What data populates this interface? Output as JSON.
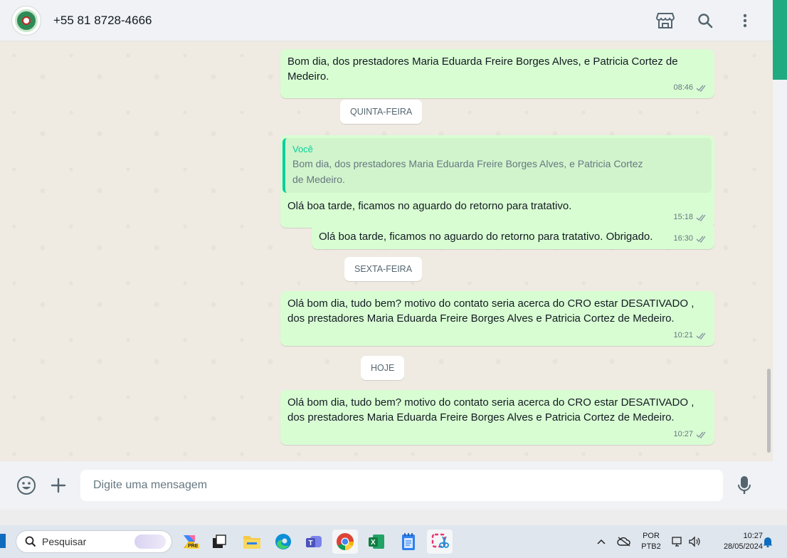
{
  "header": {
    "contact_name": "+55 81 8728-4666",
    "icons": [
      "store-icon",
      "search-icon",
      "more-vertical-icon"
    ],
    "accent": "#1faa80"
  },
  "messages": [
    {
      "text": "Bom dia, dos prestadores Maria Eduarda Freire Borges Alves, e Patricia Cortez de Medeiro.",
      "time": "08:46"
    },
    {
      "date": "QUINTA-FEIRA"
    },
    {
      "quote_author": "Você",
      "quote_text": "Bom dia, dos prestadores Maria Eduarda Freire Borges Alves, e Patricia Cortez de Medeiro.",
      "text": "Olá boa tarde, ficamos no aguardo do retorno para tratativo.",
      "time": "15:18"
    },
    {
      "text": "Olá boa tarde, ficamos no aguardo do retorno para tratativo. Obrigado.",
      "time": "16:30"
    },
    {
      "date": "SEXTA-FEIRA"
    },
    {
      "text": "Olá bom dia, tudo bem? motivo do contato seria acerca do CRO estar DESATIVADO , dos prestadores Maria Eduarda Freire Borges Alves e Patricia Cortez de Medeiro.",
      "time": "10:21"
    },
    {
      "date": "HOJE"
    },
    {
      "text": "Olá bom dia, tudo bem? motivo do contato seria acerca do CRO estar DESATIVADO , dos prestadores Maria Eduarda Freire Borges Alves e Patricia Cortez de Medeiro.",
      "time": "10:27"
    }
  ],
  "composer": {
    "placeholder": "Digite uma mensagem",
    "icons": [
      "emoji-icon",
      "plus-icon",
      "microphone-icon"
    ]
  },
  "taskbar": {
    "search_label": "Pesquisar",
    "apps": [
      "copilot-icon",
      "task-view-icon",
      "file-explorer-icon",
      "edge-icon",
      "teams-icon",
      "chrome-icon",
      "excel-icon",
      "notepad-icon",
      "snipping-tool-icon"
    ],
    "copilot_badge": "PRE",
    "language_top": "POR",
    "language_bottom": "PTB2",
    "time": "10:27",
    "date": "28/05/2024"
  },
  "colors": {
    "chat_bg": "#efeae2",
    "outgoing_bubble": "#d9fdd3",
    "quote_border": "#06cf9c",
    "header_bg": "#f0f2f5"
  }
}
